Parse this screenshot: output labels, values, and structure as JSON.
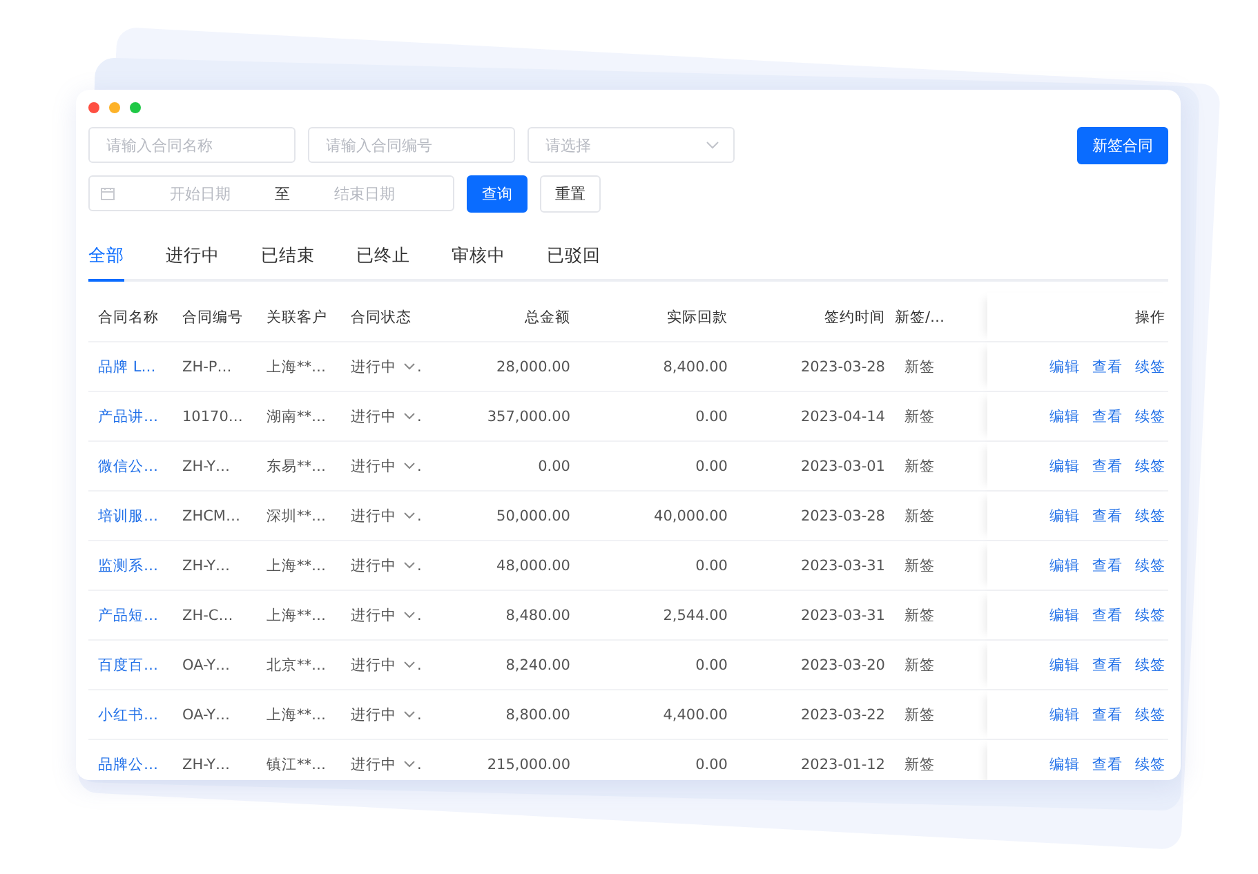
{
  "window": {
    "controls": [
      {
        "color": "#fe4f42"
      },
      {
        "color": "#fdb228"
      },
      {
        "color": "#1ec845"
      }
    ]
  },
  "filters": {
    "name": {
      "placeholder": "请输入合同名称"
    },
    "code": {
      "placeholder": "请输入合同编号"
    },
    "select": {
      "placeholder": "请选择"
    },
    "date_start": {
      "placeholder": "开始日期"
    },
    "date_sep": "至",
    "date_end": {
      "placeholder": "结束日期"
    },
    "query_button": "查询",
    "reset_button": "重置"
  },
  "new_button": "新签合同",
  "tabs": [
    {
      "label": "全部",
      "selected": true
    },
    {
      "label": "进行中",
      "selected": false
    },
    {
      "label": "已结束",
      "selected": false
    },
    {
      "label": "已终止",
      "selected": false
    },
    {
      "label": "审核中",
      "selected": false
    },
    {
      "label": "已驳回",
      "selected": false
    }
  ],
  "table": {
    "columns": [
      "合同名称",
      "合同编号",
      "关联客户",
      "合同状态",
      "总金额",
      "实际回款",
      "签约时间",
      "新签/…",
      "操作"
    ],
    "rows": [
      {
        "name": "品牌 L…",
        "code": "ZH-P…",
        "customer": "上海**…",
        "status": "进行中",
        "status_tail": ".",
        "total": "28,000.00",
        "paid": "8,400.00",
        "date": "2023-03-28",
        "type": "新签",
        "actions": [
          "编辑",
          "查看",
          "续签"
        ]
      },
      {
        "name": "产品讲…",
        "code": "10170…",
        "customer": "湖南**…",
        "status": "进行中",
        "status_tail": ".",
        "total": "357,000.00",
        "paid": "0.00",
        "date": "2023-04-14",
        "type": "新签",
        "actions": [
          "编辑",
          "查看",
          "续签"
        ]
      },
      {
        "name": "微信公…",
        "code": "ZH-Y…",
        "customer": "东易**…",
        "status": "进行中",
        "status_tail": ".",
        "total": "0.00",
        "paid": "0.00",
        "date": "2023-03-01",
        "type": "新签",
        "actions": [
          "编辑",
          "查看",
          "续签"
        ]
      },
      {
        "name": "培训服…",
        "code": "ZHCM…",
        "customer": "深圳**…",
        "status": "进行中",
        "status_tail": ".",
        "total": "50,000.00",
        "paid": "40,000.00",
        "date": "2023-03-28",
        "type": "新签",
        "actions": [
          "编辑",
          "查看",
          "续签"
        ]
      },
      {
        "name": "监测系…",
        "code": "ZH-Y…",
        "customer": "上海**…",
        "status": "进行中",
        "status_tail": ".",
        "total": "48,000.00",
        "paid": "0.00",
        "date": "2023-03-31",
        "type": "新签",
        "actions": [
          "编辑",
          "查看",
          "续签"
        ]
      },
      {
        "name": "产品短…",
        "code": "ZH-C…",
        "customer": "上海**…",
        "status": "进行中",
        "status_tail": ".",
        "total": "8,480.00",
        "paid": "2,544.00",
        "date": "2023-03-31",
        "type": "新签",
        "actions": [
          "编辑",
          "查看",
          "续签"
        ]
      },
      {
        "name": "百度百…",
        "code": "OA-Y…",
        "customer": "北京**…",
        "status": "进行中",
        "status_tail": ".",
        "total": "8,240.00",
        "paid": "0.00",
        "date": "2023-03-20",
        "type": "新签",
        "actions": [
          "编辑",
          "查看",
          "续签"
        ]
      },
      {
        "name": "小红书…",
        "code": "OA-Y…",
        "customer": "上海**…",
        "status": "进行中",
        "status_tail": ".",
        "total": "8,800.00",
        "paid": "4,400.00",
        "date": "2023-03-22",
        "type": "新签",
        "actions": [
          "编辑",
          "查看",
          "续签"
        ]
      },
      {
        "name": "品牌公…",
        "code": "ZH-Y…",
        "customer": "镇江**…",
        "status": "进行中",
        "status_tail": ".",
        "total": "215,000.00",
        "paid": "0.00",
        "date": "2023-01-12",
        "type": "新签",
        "actions": [
          "编辑",
          "查看",
          "续签"
        ]
      }
    ]
  }
}
